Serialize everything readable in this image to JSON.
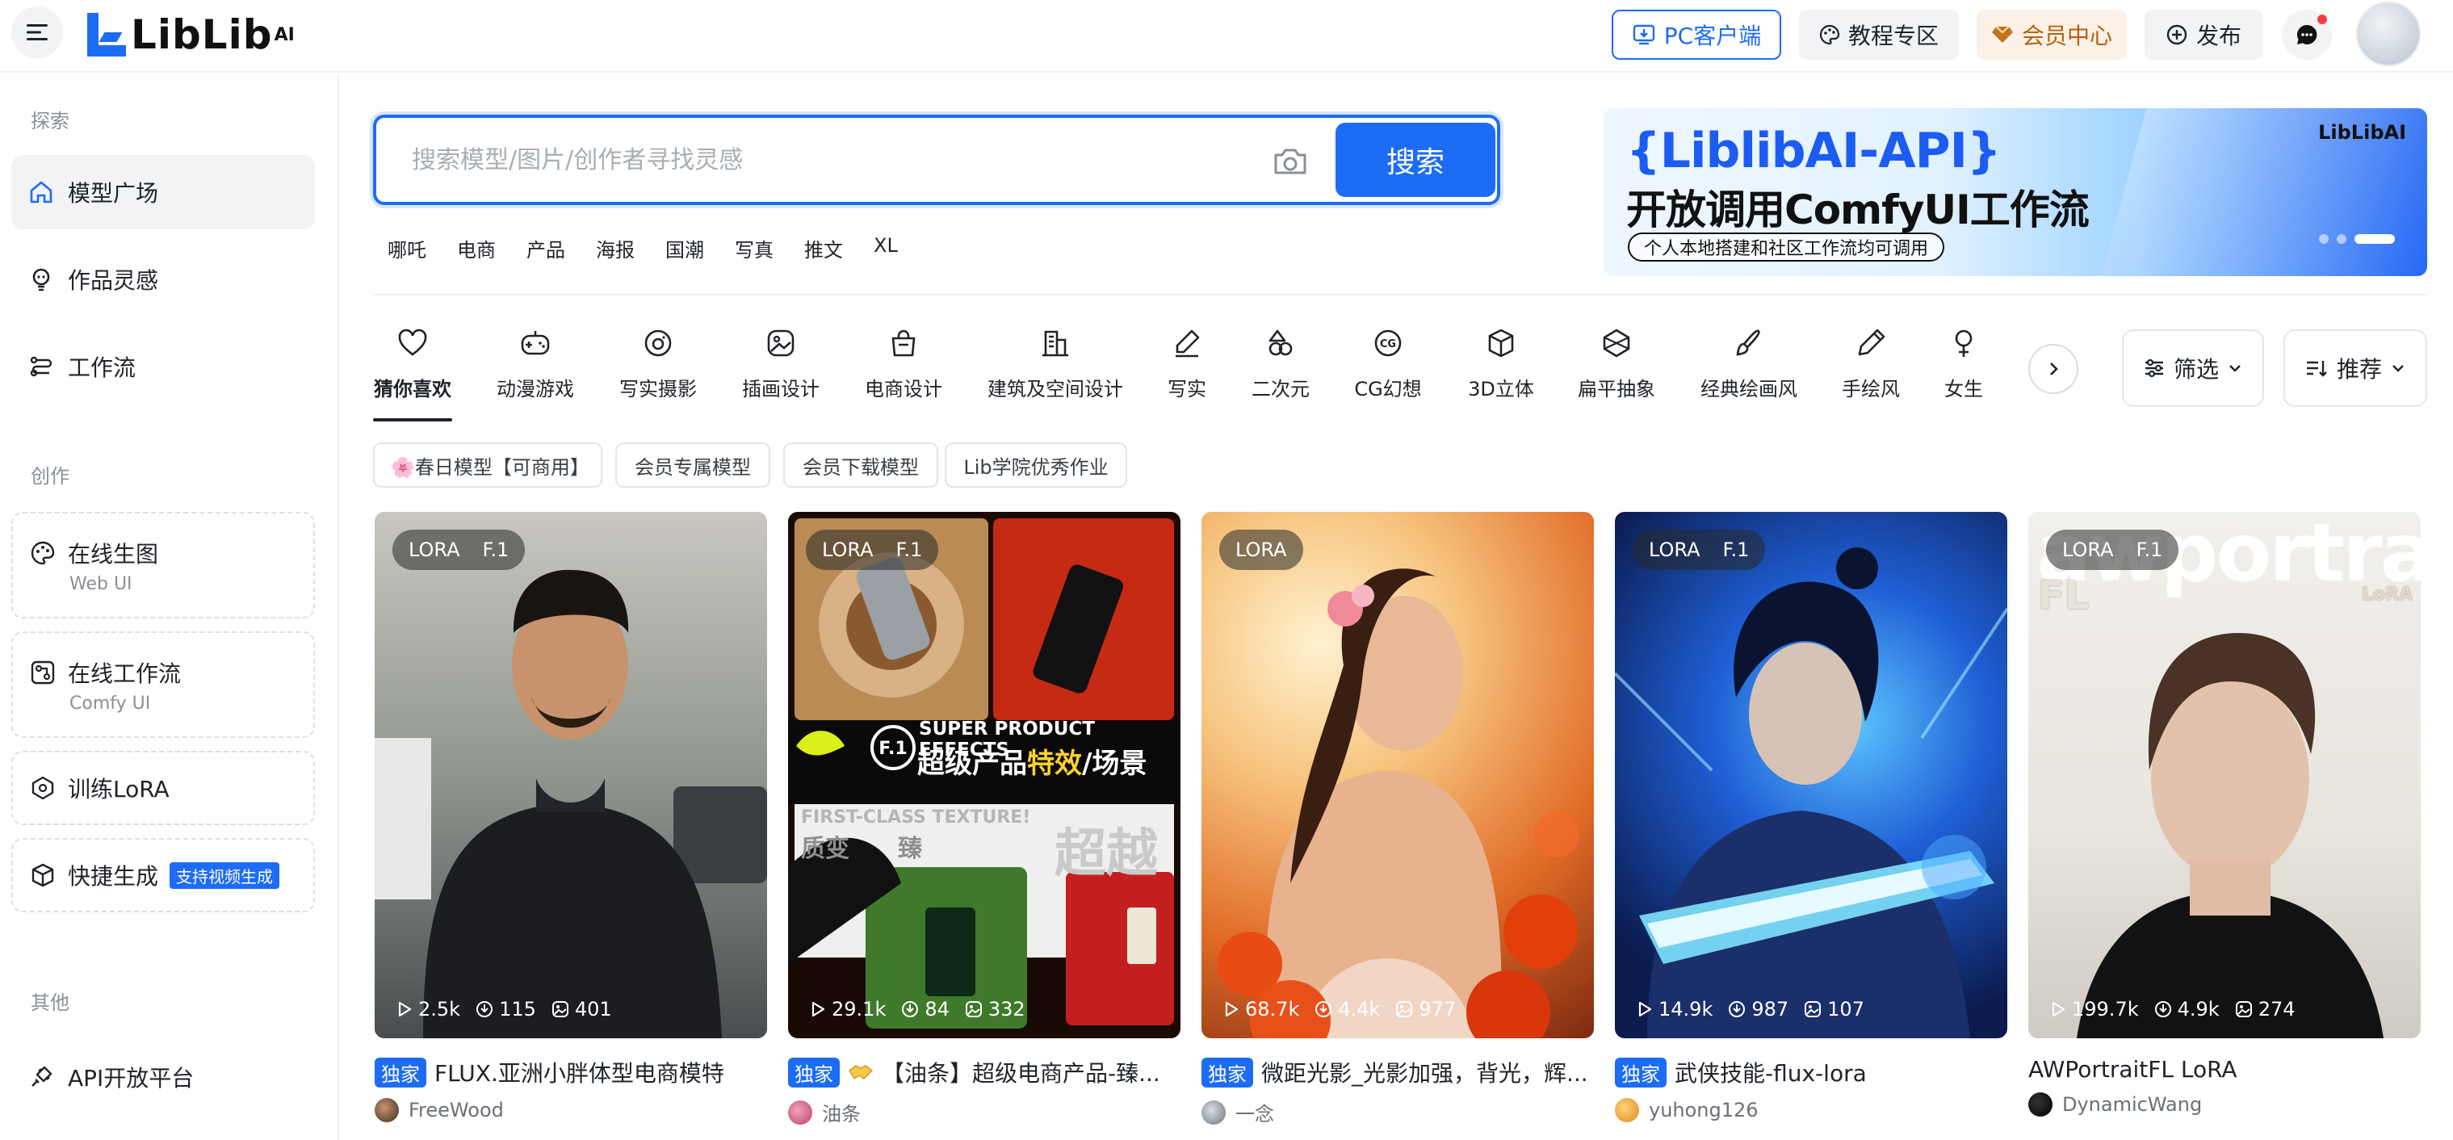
{
  "header": {
    "logo_text": "LibLib",
    "logo_sup": "AI",
    "pc_client": "PC客户端",
    "tutorials": "教程专区",
    "vip_center": "会员中心",
    "publish": "发布"
  },
  "sidebar": {
    "explore_label": "探索",
    "explore_items": [
      "模型广场",
      "作品灵感",
      "工作流"
    ],
    "create_label": "创作",
    "create_items": [
      {
        "title": "在线生图",
        "sub": "Web UI"
      },
      {
        "title": "在线工作流",
        "sub": "Comfy UI"
      },
      {
        "title": "训练LoRA",
        "sub": ""
      },
      {
        "title": "快捷生成",
        "sub": "",
        "tag": "支持视频生成"
      }
    ],
    "other_label": "其他",
    "other_items": [
      "API开放平台"
    ]
  },
  "search": {
    "placeholder": "搜索模型/图片/创作者寻找灵感",
    "button": "搜索",
    "hot_tags": [
      "哪吒",
      "电商",
      "产品",
      "海报",
      "国潮",
      "写真",
      "推文",
      "XL"
    ]
  },
  "banner": {
    "title": "{LiblibAI-API}",
    "subtitle": "开放调用ComfyUI工作流",
    "pill": "个人本地搭建和社区工作流均可调用",
    "logo": "LibLibAI"
  },
  "categories": [
    "猜你喜欢",
    "动漫游戏",
    "写实摄影",
    "插画设计",
    "电商设计",
    "建筑及空间设计",
    "写实",
    "二次元",
    "CG幻想",
    "3D立体",
    "扁平抽象",
    "经典绘画风",
    "手绘风",
    "女生"
  ],
  "active_category": "猜你喜欢",
  "filters": {
    "filter": "筛选",
    "sort": "推荐"
  },
  "chips": [
    "🌸春日模型【可商用】",
    "会员专属模型",
    "会员下载模型",
    "Lib学院优秀作业"
  ],
  "cards": [
    {
      "badges": [
        "LORA",
        "F.1"
      ],
      "runs": "2.5k",
      "downloads": "115",
      "images": "401",
      "exclusive": "独家",
      "title": "FLUX.亚洲小胖体型电商模特",
      "author": "FreeWood"
    },
    {
      "badges": [
        "LORA",
        "F.1"
      ],
      "runs": "29.1k",
      "downloads": "84",
      "images": "332",
      "exclusive": "独家",
      "title": "【油条】超级电商产品-臻...",
      "author": "油条",
      "art_text": {
        "line1": "SUPER PRODUCT EFFECTS",
        "line2": "超级产品",
        "line2b": "特效",
        "line2c": "/场景",
        "line3": "FIRST-CLASS TEXTURE!",
        "line4": "质变",
        "line4b": "臻",
        "line5": "超越"
      }
    },
    {
      "badges": [
        "LORA"
      ],
      "runs": "68.7k",
      "downloads": "4.4k",
      "images": "977",
      "exclusive": "独家",
      "title": "微距光影_光影加强，背光，辉...",
      "author": "一念"
    },
    {
      "badges": [
        "LORA",
        "F.1"
      ],
      "runs": "14.9k",
      "downloads": "987",
      "images": "107",
      "exclusive": "独家",
      "title": "武侠技能-flux-lora",
      "author": "yuhong126"
    },
    {
      "badges": [
        "LORA",
        "F.1"
      ],
      "runs": "199.7k",
      "downloads": "4.9k",
      "images": "274",
      "exclusive": "",
      "title": "AWPortraitFL LoRA",
      "author": "DynamicWang",
      "art_text": {
        "line1": "awportrait",
        "line2": "FL",
        "line3": "LoRA"
      }
    }
  ],
  "colors": {
    "accent": "#1d6cf6",
    "vip": "#b5610f"
  }
}
